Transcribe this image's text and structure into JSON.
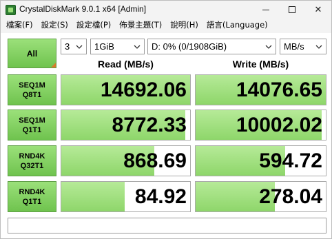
{
  "window": {
    "title": "CrystalDiskMark 9.0.1 x64 [Admin]",
    "minimize_label": "",
    "close_label": "✕"
  },
  "menu": {
    "items": [
      "檔案(F)",
      "設定(S)",
      "設定檔(P)",
      "佈景主題(T)",
      "說明(H)",
      "語言(Language)"
    ]
  },
  "toolbar": {
    "all_label": "All",
    "count": "3",
    "size": "1GiB",
    "drive": "D: 0% (0/1908GiB)",
    "unit": "MB/s"
  },
  "headers": {
    "read": "Read (MB/s)",
    "write": "Write (MB/s)"
  },
  "tests": [
    {
      "line1": "SEQ1M",
      "line2": "Q8T1",
      "read": "14692.06",
      "write": "14076.65",
      "read_fill": 1.0,
      "write_fill": 1.0
    },
    {
      "line1": "SEQ1M",
      "line2": "Q1T1",
      "read": "8772.33",
      "write": "10002.02",
      "read_fill": 0.96,
      "write_fill": 0.97
    },
    {
      "line1": "RND4K",
      "line2": "Q32T1",
      "read": "868.69",
      "write": "594.72",
      "read_fill": 0.72,
      "write_fill": 0.69
    },
    {
      "line1": "RND4K",
      "line2": "Q1T1",
      "read": "84.92",
      "write": "278.04",
      "read_fill": 0.49,
      "write_fill": 0.61
    }
  ],
  "comment": "",
  "colors": {
    "bar_green": "#8ed66a",
    "button_green": "#6fc34e",
    "corner_orange": "#d97a2a"
  }
}
